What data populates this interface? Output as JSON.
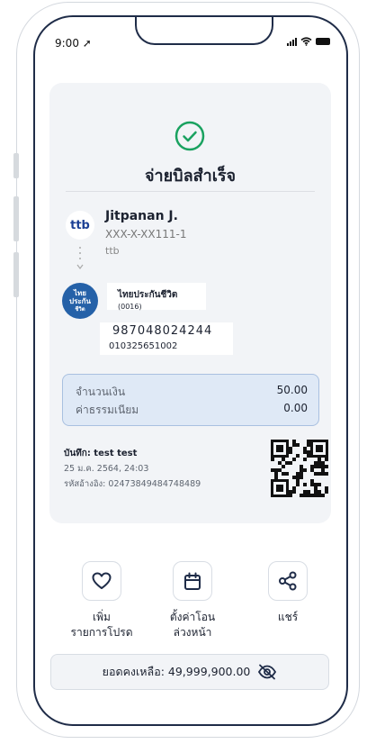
{
  "status_bar": {
    "time": "9:00"
  },
  "receipt": {
    "title": "จ่ายบิลสำเร็จ",
    "from": {
      "bank_logo": "ttb",
      "name": "Jitpanan J.",
      "account": "XXX-X-XX111-1",
      "bank": "ttb"
    },
    "to": {
      "logo_lines": [
        "ไทย",
        "ประกัน",
        "ชีวิต"
      ],
      "name": "ไทยประกันชีวิต",
      "code": "(0016)",
      "ref1": "987048024244",
      "ref2": "010325651002"
    },
    "amount": {
      "label": "จำนวนเงิน",
      "value": "50.00"
    },
    "fee": {
      "label": "ค่าธรรมเนียม",
      "value": "0.00"
    },
    "memo": "บันทึก: test test",
    "date": "25 ม.ค. 2564, 24:03",
    "ref_id": "รหัสอ้างอิง: 02473849484748489"
  },
  "actions": [
    {
      "icon": "heart-icon",
      "label_lines": [
        "เพิ่ม",
        "รายการโปรด"
      ]
    },
    {
      "icon": "calendar-icon",
      "label_lines": [
        "ตั้งค่าโอน",
        "ล่วงหน้า"
      ]
    },
    {
      "icon": "share-icon",
      "label_lines": [
        "แชร์"
      ]
    }
  ],
  "balance": {
    "text": "ยอดคงเหลือ: 49,999,900.00",
    "icon": "eye-off-icon"
  },
  "colors": {
    "success": "#1aa260",
    "primary_dark": "#1f2c48",
    "amount_bg": "#dfe9f6",
    "ttb_blue": "#1b3f94",
    "ttb_orange": "#f26f21"
  }
}
